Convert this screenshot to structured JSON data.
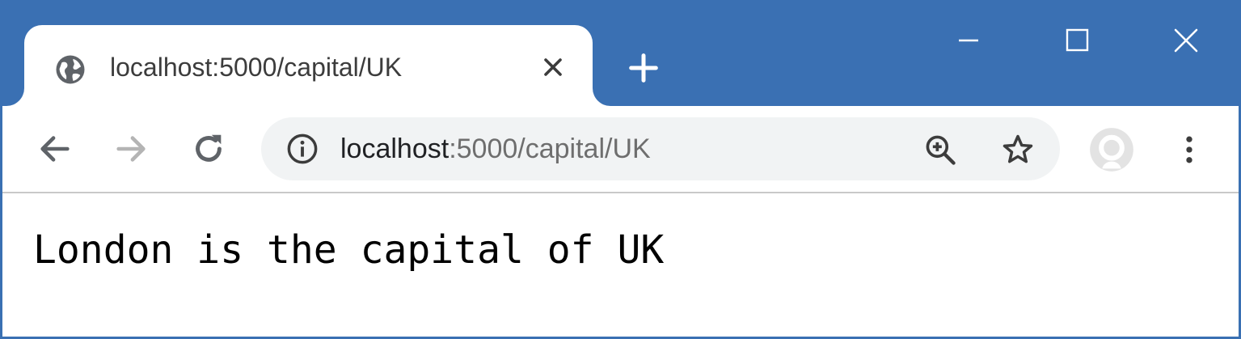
{
  "tab": {
    "title": "localhost:5000/capital/UK",
    "favicon": "globe-icon",
    "close_icon": "close-icon"
  },
  "new_tab_icon": "plus-icon",
  "window_controls": [
    "minimize-icon",
    "maximize-icon",
    "close-icon"
  ],
  "toolbar": {
    "back_icon": "arrow-left-icon",
    "forward_icon": "arrow-right-icon",
    "reload_icon": "reload-icon",
    "address": {
      "info_icon": "info-icon",
      "host": "localhost",
      "rest": ":5000/capital/UK"
    },
    "zoom_icon": "zoom-in-icon",
    "bookmark_icon": "star-icon",
    "profile_icon": "avatar",
    "menu_icon": "vertical-dots-icon"
  },
  "page": {
    "text": "London is the capital of UK"
  },
  "colors": {
    "frame": "#3a70b3",
    "omnibox": "#f1f3f4",
    "url_host": "#202124",
    "url_rest": "#6e6e6e",
    "icon": "#5f6368",
    "icon_disabled": "#b4b4b4"
  }
}
